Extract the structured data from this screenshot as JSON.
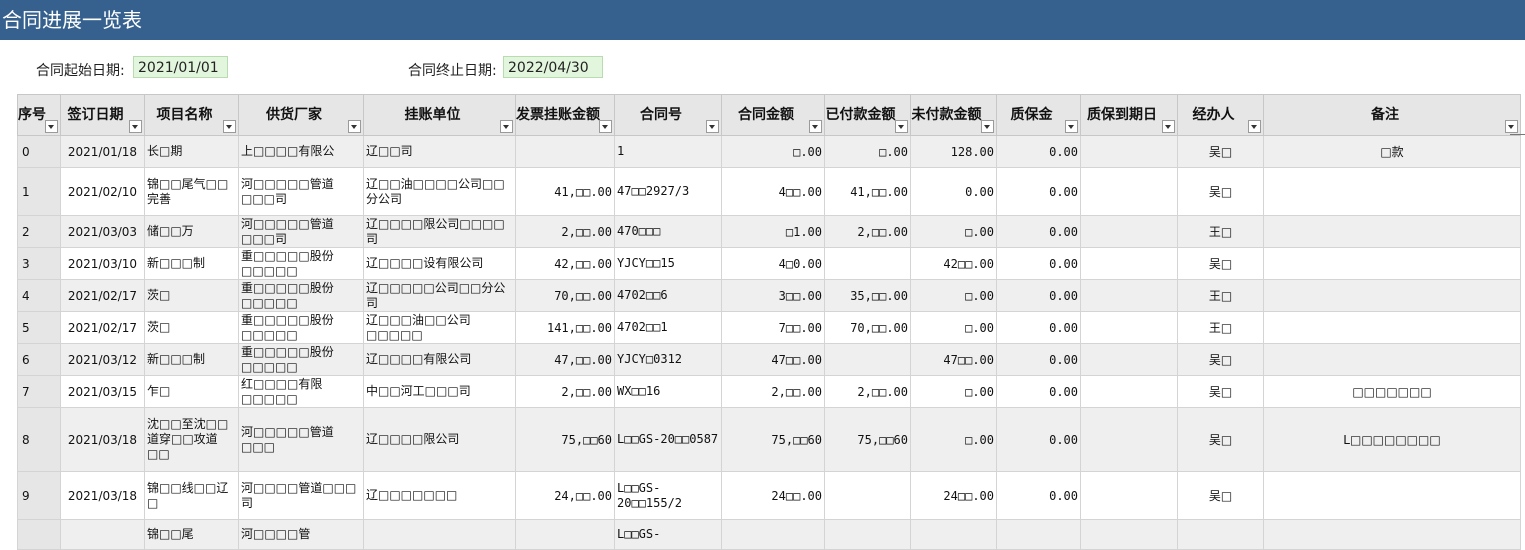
{
  "title": "合同进展一览表",
  "dates": {
    "start_label": "合同起始日期:",
    "start_value": "2021/01/01",
    "end_label": "合同终止日期:",
    "end_value": "2022/04/30"
  },
  "columns": [
    "序号",
    "签订日期",
    "项目名称",
    "供货厂家",
    "挂账单位",
    "发票挂账金额",
    "合同号",
    "合同金额",
    "已付款金额",
    "未付款金额",
    "质保金",
    "质保到期日",
    "经办人",
    "备注"
  ],
  "rows": [
    [
      "0",
      "2021/01/18",
      "长□期",
      "上□□□□有限公",
      "辽□□司",
      "",
      "1",
      "□.00",
      "□.00",
      "128.00",
      "0.00",
      "",
      "吴□",
      "□款"
    ],
    [
      "1",
      "2021/02/10",
      "锦□□尾气□□完善",
      "河□□□□□管道□□□司",
      "辽□□油□□□□公司□□分公司",
      "41,□□.00",
      "47□□2927/3",
      "4□□.00",
      "41,□□.00",
      "0.00",
      "0.00",
      "",
      "吴□",
      ""
    ],
    [
      "2",
      "2021/03/03",
      "储□□万",
      "河□□□□□管道□□□司",
      "辽□□□□限公司□□□□司",
      "2,□□.00",
      "470□□□",
      "□1.00",
      "2,□□.00",
      "□.00",
      "0.00",
      "",
      "王□",
      ""
    ],
    [
      "3",
      "2021/03/10",
      "新□□□制",
      "重□□□□□股份□□□□□",
      "辽□□□□设有限公司",
      "42,□□.00",
      "YJCY□□15",
      "4□0.00",
      "",
      "42□□.00",
      "0.00",
      "",
      "吴□",
      ""
    ],
    [
      "4",
      "2021/02/17",
      "茨□",
      "重□□□□□股份□□□□□",
      "辽□□□□□公司□□分公司",
      "70,□□.00",
      "4702□□6",
      "3□□.00",
      "35,□□.00",
      "□.00",
      "0.00",
      "",
      "王□",
      ""
    ],
    [
      "5",
      "2021/02/17",
      "茨□",
      "重□□□□□股份□□□□□",
      "辽□□□油□□公司□□□□□",
      "141,□□.00",
      "4702□□1",
      "7□□.00",
      "70,□□.00",
      "□.00",
      "0.00",
      "",
      "王□",
      ""
    ],
    [
      "6",
      "2021/03/12",
      "新□□□制",
      "重□□□□□股份□□□□□",
      "辽□□□□有限公司",
      "47,□□.00",
      "YJCY□0312",
      "47□□.00",
      "",
      "47□□.00",
      "0.00",
      "",
      "吴□",
      ""
    ],
    [
      "7",
      "2021/03/15",
      "乍□",
      "红□□□□有限□□□□□",
      "中□□河工□□□司",
      "2,□□.00",
      "WX□□16",
      "2,□□.00",
      "2,□□.00",
      "□.00",
      "0.00",
      "",
      "吴□",
      "□□□□□□□"
    ],
    [
      "8",
      "2021/03/18",
      "沈□□至沈□□道穿□□攻道□□",
      "河□□□□□管道□□□",
      "辽□□□□限公司",
      "75,□□60",
      "L□□GS-20□□0587",
      "75,□□60",
      "75,□□60",
      "□.00",
      "0.00",
      "",
      "吴□",
      "L□□□□□□□□"
    ],
    [
      "9",
      "2021/03/18",
      "锦□□线□□辽□",
      "河□□□□管道□□□司",
      "辽□□□□□□□",
      "24,□□.00",
      "L□□GS-20□□155/2",
      "24□□.00",
      "",
      "24□□.00",
      "0.00",
      "",
      "吴□",
      ""
    ],
    [
      "",
      "",
      "锦□□尾",
      "河□□□□管",
      "",
      "",
      "L□□GS-",
      "",
      "",
      "",
      "",
      "",
      "",
      ""
    ]
  ]
}
